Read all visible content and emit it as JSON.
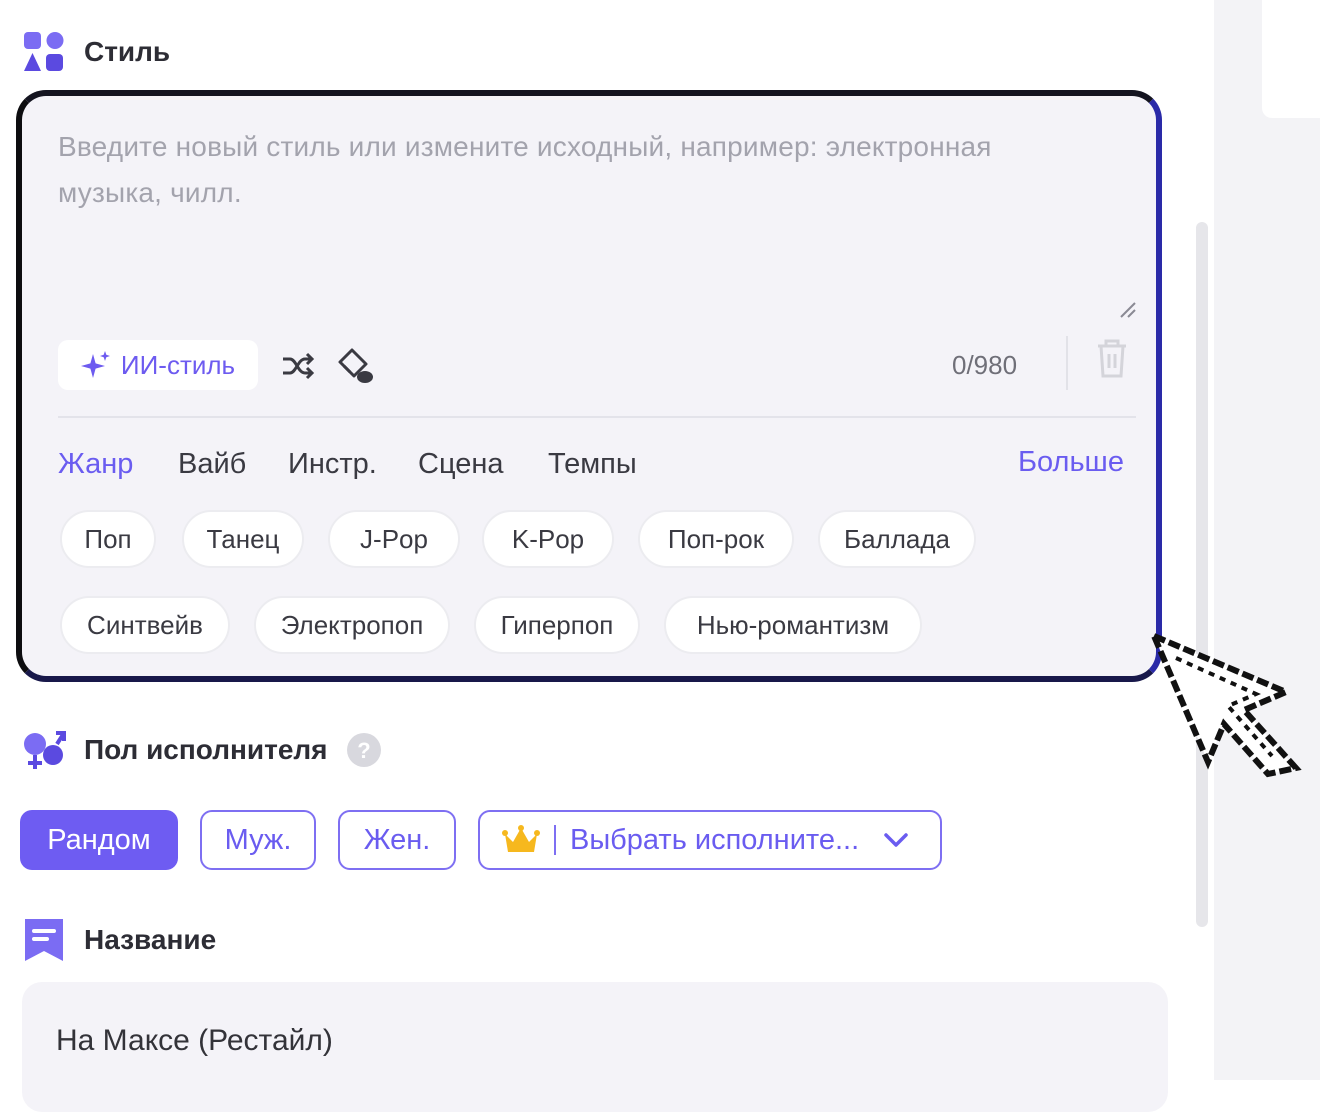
{
  "style_section": {
    "title": "Стиль",
    "icon": "shapes-grid-icon",
    "textarea_placeholder_line1": "Введите новый стиль или измените исходный, например: электронная",
    "textarea_placeholder_line2": "музыка, чилл.",
    "ai_style_label": "ИИ-стиль",
    "char_count": "0/980",
    "tabs": [
      {
        "label": "Жанр",
        "active": true
      },
      {
        "label": "Вайб",
        "active": false
      },
      {
        "label": "Инстр.",
        "active": false
      },
      {
        "label": "Сцена",
        "active": false
      },
      {
        "label": "Темпы",
        "active": false
      }
    ],
    "more_label": "Больше",
    "chips": [
      "Поп",
      "Танец",
      "J-Pop",
      "K-Pop",
      "Поп-рок",
      "Баллада",
      "Синтвейв",
      "Электропоп",
      "Гиперпоп",
      "Нью-романтизм"
    ]
  },
  "gender_section": {
    "title": "Пол исполнителя",
    "icon": "gender-icon",
    "options": [
      "Рандом",
      "Муж.",
      "Жен."
    ],
    "selected": "Рандом",
    "artist_select_label": "Выбрать исполните..."
  },
  "name_section": {
    "title": "Название",
    "icon": "bookmark-title-icon",
    "value": "На Максе (Рестайл)"
  },
  "colors": {
    "accent": "#6e5cf2",
    "card_background": "#f4f3f8",
    "card_border": "#2a2aa8"
  }
}
